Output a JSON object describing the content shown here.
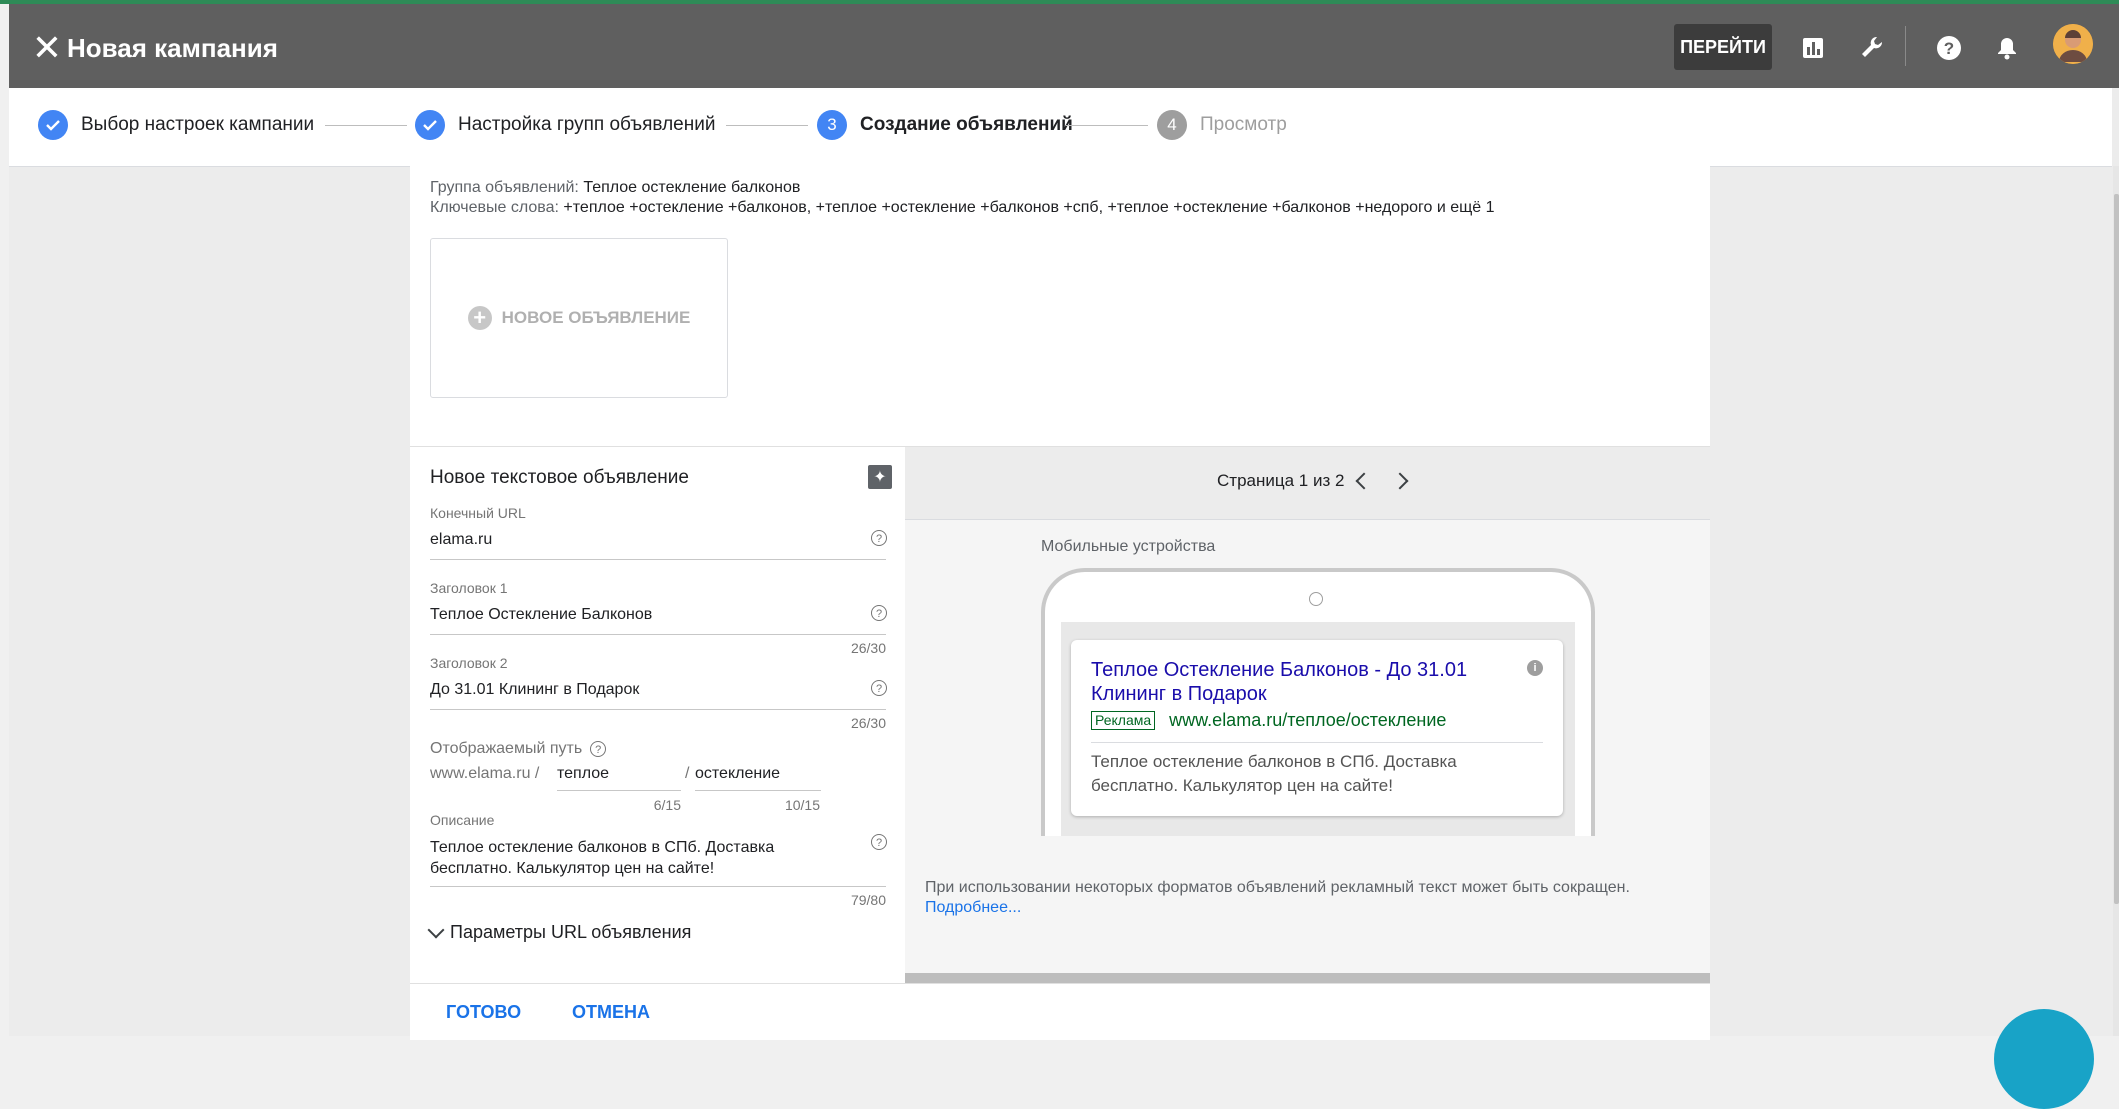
{
  "header": {
    "title": "Новая кампания",
    "goto_label": "ПЕРЕЙТИ",
    "icons": [
      "close-icon",
      "reports-icon",
      "tools-icon",
      "help-icon",
      "notifications-icon"
    ]
  },
  "stepper": {
    "steps": [
      {
        "label": "Выбор настроек кампании",
        "state": "done"
      },
      {
        "label": "Настройка групп объявлений",
        "state": "done"
      },
      {
        "label": "Создание объявлений",
        "state": "current",
        "number": "3"
      },
      {
        "label": "Просмотр",
        "state": "pending",
        "number": "4"
      }
    ]
  },
  "group": {
    "group_label": "Группа объявлений:",
    "group_name": "Теплое остекление балконов",
    "keywords_label": "Ключевые слова:",
    "keywords": "+теплое +остекление +балконов, +теплое +остекление +балконов +спб, +теплое +остекление +балконов +недорого и ещё 1"
  },
  "new_ad_tile": {
    "label": "НОВОЕ ОБЪЯВЛЕНИЕ"
  },
  "form": {
    "title": "Новое текстовое объявление",
    "final_url": {
      "label": "Конечный URL",
      "value": "elama.ru"
    },
    "headline1": {
      "label": "Заголовок 1",
      "value": "Теплое Остекление Балконов",
      "counter": "26/30"
    },
    "headline2": {
      "label": "Заголовок 2",
      "value": "До 31.01 Клининг в Подарок",
      "counter": "26/30"
    },
    "display_path": {
      "label": "Отображаемый путь",
      "domain": "www.elama.ru /",
      "path1": "теплое",
      "sep": "/",
      "path2": "остекление",
      "counter1": "6/15",
      "counter2": "10/15"
    },
    "description": {
      "label": "Описание",
      "line1": "Теплое остекление балконов в СПб. Доставка",
      "line2": "бесплатно. Калькулятор цен на сайте!",
      "counter": "79/80"
    },
    "url_params_label": "Параметры URL объявления"
  },
  "preview": {
    "pager": "Страница 1 из 2",
    "device": "Мобильные устройства",
    "ad": {
      "headline_line1": "Теплое Остекление Балконов - До 31.01",
      "headline_line2": "Клининг в Подарок",
      "badge": "Реклама",
      "url": "www.elama.ru/теплое/остекление",
      "desc_line1": "Теплое остекление балконов в СПб. Доставка",
      "desc_line2": "бесплатно. Калькулятор цен на сайте!"
    },
    "notice": "При использовании некоторых форматов объявлений рекламный текст может быть сокращен.",
    "learn_more": "Подробнее..."
  },
  "actions": {
    "done": "ГОТОВО",
    "cancel": "ОТМЕНА"
  },
  "colors": {
    "topbar": "#5f5f5f",
    "accent": "#4285f4",
    "link": "#1a0dab",
    "ad_green": "#006621"
  }
}
